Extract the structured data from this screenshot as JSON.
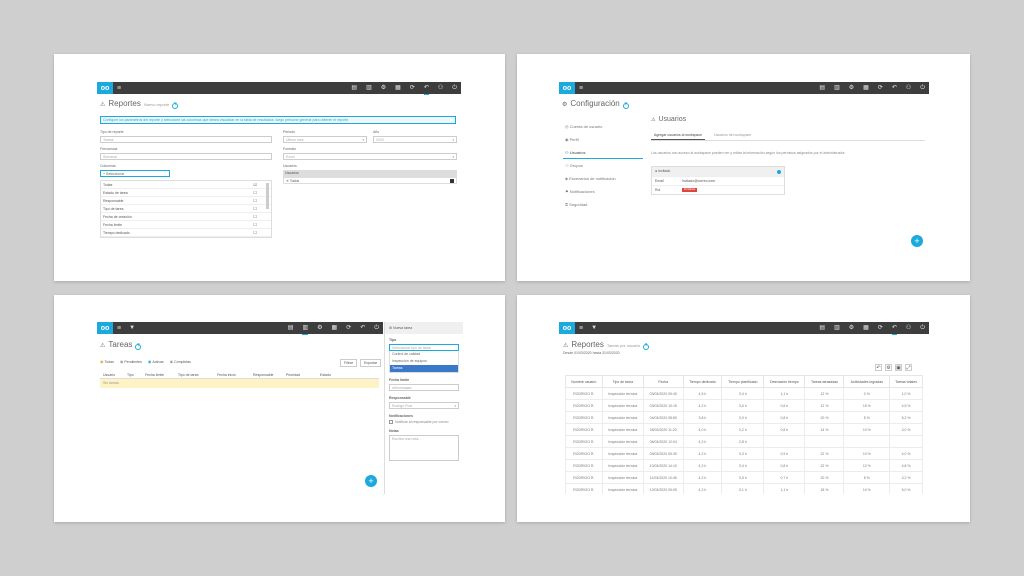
{
  "brand": {
    "accent": "#1ba9de",
    "topbar_bg": "#3d3d3d",
    "canvas_bg": "#cfcfcf",
    "logo_text": "oo"
  },
  "topbar_icons": [
    "building-icon",
    "list-icon",
    "gear-icon",
    "chart-icon",
    "share-icon",
    "refresh-icon",
    "people-icon",
    "power-icon"
  ],
  "panel1": {
    "title": "Reportes",
    "subtitle": "Nuevo reporte",
    "info_banner": "Configure los parámetros del reporte y seleccione las columnas que desea visualizar en la tabla de resultados, luego presione generar para obtener el reporte.",
    "left": {
      "label_tipo": "Tipo de reporte",
      "tipo_value": "Tareas",
      "label_frecuencia": "Frecuencia",
      "frecuencia_value": "Semanal",
      "label_columnas": "Columnas",
      "columnas_value": "+ Seleccionar",
      "options": [
        {
          "label": "Todas",
          "checked": true
        },
        {
          "label": "Estado de tarea",
          "checked": false
        },
        {
          "label": "Responsable",
          "checked": false
        },
        {
          "label": "Tipo de tarea",
          "checked": false
        },
        {
          "label": "Fecha de creación",
          "checked": false
        },
        {
          "label": "Fecha límite",
          "checked": false
        },
        {
          "label": "Tiempo dedicado",
          "checked": false
        }
      ]
    },
    "right": {
      "label_periodo": "Periodo",
      "periodo_value": "Último mes",
      "label_anio": "Año",
      "anio_value": "2020",
      "label_formato": "Formato",
      "formato_value": "Excel",
      "label_usuarios": "Usuarios",
      "usuarios_header": "Usuarios",
      "usuario_item": "Todos"
    }
  },
  "panel2": {
    "title": "Configuración",
    "sidebar": [
      "Cuenta de usuario",
      "Perfil",
      "Usuarios",
      "Grupos",
      "Escenarios de notificación",
      "Notificaciones",
      "Seguridad"
    ],
    "sidebar_icons": [
      "account-icon",
      "profile-icon",
      "users-icon",
      "groups-icon",
      "scenario-icon",
      "bell-icon",
      "lock-icon"
    ],
    "active_index": 2,
    "section_title": "Usuarios",
    "tabs": [
      "Agregar usuarios al workspace",
      "Usuarios del workspace"
    ],
    "description": "Los usuarios con acceso al workspace pueden ver y editar la información según los permisos asignados por el administrador.",
    "user_card": {
      "name": "Invitado",
      "rows": [
        {
          "key": "Email",
          "value": "invitado@correo.com"
        },
        {
          "key": "Rol",
          "value": "Pendiente"
        }
      ]
    }
  },
  "panel3": {
    "title": "Tareas",
    "filters": [
      "Todas",
      "Pendientes",
      "Activas",
      "Completas"
    ],
    "buttons": [
      "Filtrar",
      "Exportar"
    ],
    "columns": [
      "Usuario",
      "Tipo",
      "Fecha límite",
      "Tipo de tarea",
      "Fecha inicio",
      "Responsable",
      "Prioridad",
      "Estado"
    ],
    "empty_row": "Sin tareas",
    "side": {
      "header": "Nueva tarea",
      "label_tipo": "Tipo",
      "dropdown_value": "Seleccionar tipo de tarea",
      "dropdown_options": [
        "Control de calidad",
        "Inspección de equipos",
        "Tareas"
      ],
      "selected_option": "Tareas",
      "label_fecha": "Fecha límite",
      "fecha_value": "dd/mm/aaaa",
      "label_responsable": "Responsable",
      "responsable_value": "Rodrigo Ruiz",
      "label_notificar": "Notificaciones",
      "checkbox_label": "Notificar al responsable por correo",
      "label_notas": "Notas",
      "notas_placeholder": "Escriba una nota..."
    }
  },
  "panel4": {
    "title": "Reportes",
    "subtitle": "Tareas por usuario",
    "range": "Desde 01/03/2020 hasta 31/03/2020",
    "columns": [
      "Nombre usuario",
      "Tipo de tarea",
      "Fecha",
      "Tiempo dedicado",
      "Tiempo planificado",
      "Desviación tiempo",
      "Tareas atrasadas",
      "Actividades logradas",
      "Tareas totales"
    ],
    "rows": [
      [
        "RODRIGO R.",
        "Inspección técnica",
        "03/03/2020 09:40",
        "4,5 h",
        "3,4 h",
        "1,1 h",
        "12 %",
        "0 %",
        "1,0 %"
      ],
      [
        "RODRIGO R.",
        "Inspección técnica",
        "03/03/2020 10:15",
        "4,2 h",
        "3,6 h",
        "0,6 h",
        "12 %",
        "15 %",
        "4,5 %"
      ],
      [
        "RODRIGO R.",
        "Inspección técnica",
        "04/03/2020 08:50",
        "3,8 h",
        "3,0 h",
        "0,8 h",
        "20 %",
        "5 %",
        "5,2 %"
      ],
      [
        "RODRIGO R.",
        "Inspección técnica",
        "05/03/2020 11:20",
        "4,0 h",
        "3,2 h",
        "0,8 h",
        "14 %",
        "10 %",
        "3,0 %"
      ],
      [
        "RODRIGO R.",
        "Inspección técnica",
        "06/03/2020 12:04",
        "4,2 h",
        "2,8 h",
        "",
        "",
        "",
        ""
      ],
      [
        "RODRIGO R.",
        "Inspección técnica",
        "09/03/2020 09:30",
        "4,2 h",
        "3,3 h",
        "0,9 h",
        "22 %",
        "10 %",
        "4,0 %"
      ],
      [
        "RODRIGO R.",
        "Inspección técnica",
        "10/03/2020 14:10",
        "4,2 h",
        "3,4 h",
        "0,8 h",
        "22 %",
        "12 %",
        "4,8 %"
      ],
      [
        "RODRIGO R.",
        "Inspección técnica",
        "11/03/2020 10:45",
        "4,2 h",
        "3,5 h",
        "0,7 h",
        "20 %",
        "8 %",
        "3,2 %"
      ],
      [
        "RODRIGO R.",
        "Inspección técnica",
        "12/03/2020 09:05",
        "4,2 h",
        "3,1 h",
        "1,1 h",
        "18 %",
        "14 %",
        "5,0 %"
      ]
    ]
  }
}
